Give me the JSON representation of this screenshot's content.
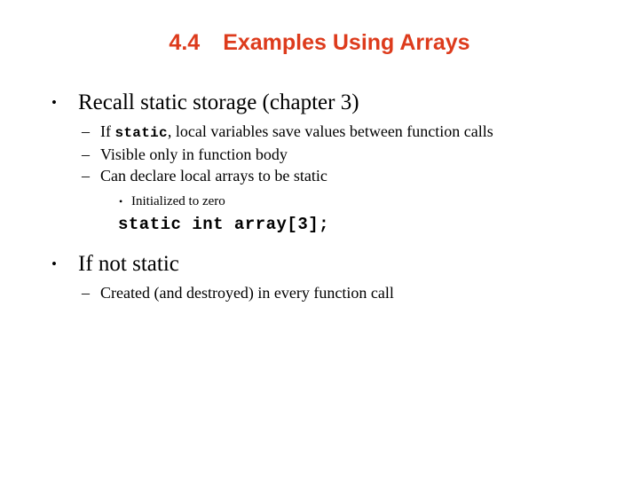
{
  "slide": {
    "background_color": "#FFFFFF",
    "title": {
      "number": "4.4",
      "text": "Examples Using Arrays",
      "color": "#DD3B1C"
    },
    "body": {
      "text_color": "#000000",
      "bullets": {
        "level1_marker": "•",
        "level2_marker": "–",
        "level3_marker": "•"
      },
      "items": [
        {
          "level": 1,
          "text": "Recall static storage (chapter 3)"
        },
        {
          "level": 2,
          "text_before": "If ",
          "mono": "static",
          "text_after": ", local variables save values between function calls"
        },
        {
          "level": 2,
          "text": "Visible only in function body"
        },
        {
          "level": 2,
          "text": "Can declare local arrays to be static"
        },
        {
          "level": 3,
          "text": "Initialized to zero"
        },
        {
          "level": "code",
          "text": "static int array[3];"
        },
        {
          "level": 1,
          "text": "If not static"
        },
        {
          "level": 2,
          "text": "Created (and destroyed) in every function call"
        }
      ]
    }
  }
}
